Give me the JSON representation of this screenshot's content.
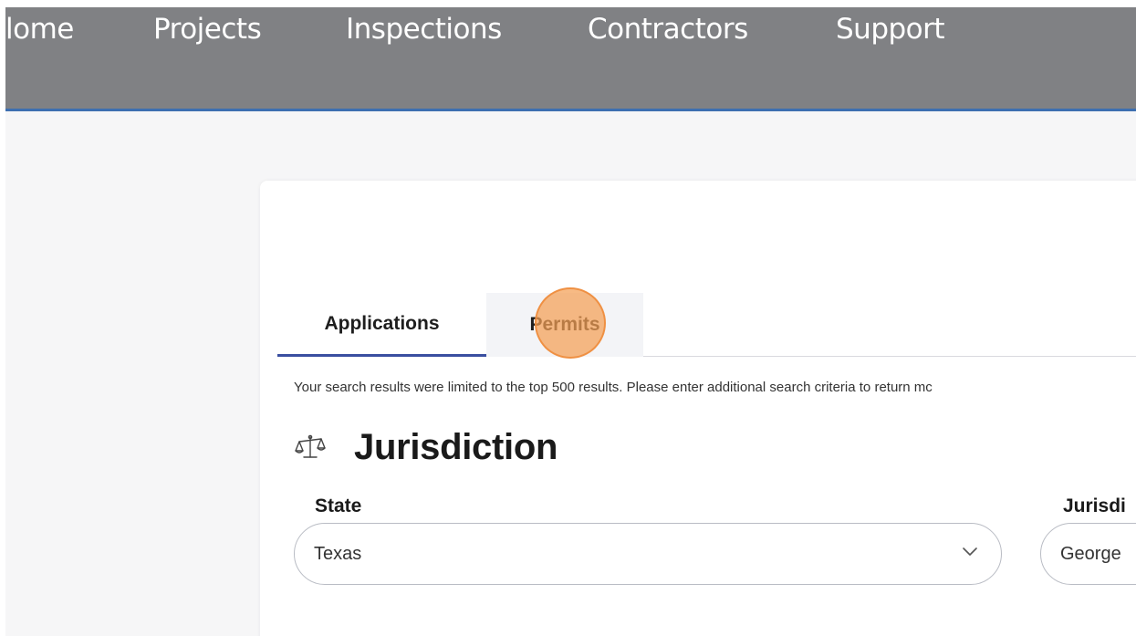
{
  "nav": {
    "items": [
      "lome",
      "Projects",
      "Inspections",
      "Contractors",
      "Support"
    ]
  },
  "tabs": {
    "applications": "Applications",
    "permits": "Permits"
  },
  "notice": "Your search results were limited to the top 500 results. Please enter additional search criteria to return mc",
  "jurisdiction_section": {
    "icon": "scale-icon",
    "title": "Jurisdiction",
    "state_label": "State",
    "state_value": "Texas",
    "jurisdiction_label": "Jurisdi",
    "jurisdiction_value": "George"
  },
  "colors": {
    "nav_bg": "#808184",
    "nav_border": "#3d6fb0",
    "active_tab_underline": "#3a4fa0",
    "click_marker": "#f4a054"
  }
}
